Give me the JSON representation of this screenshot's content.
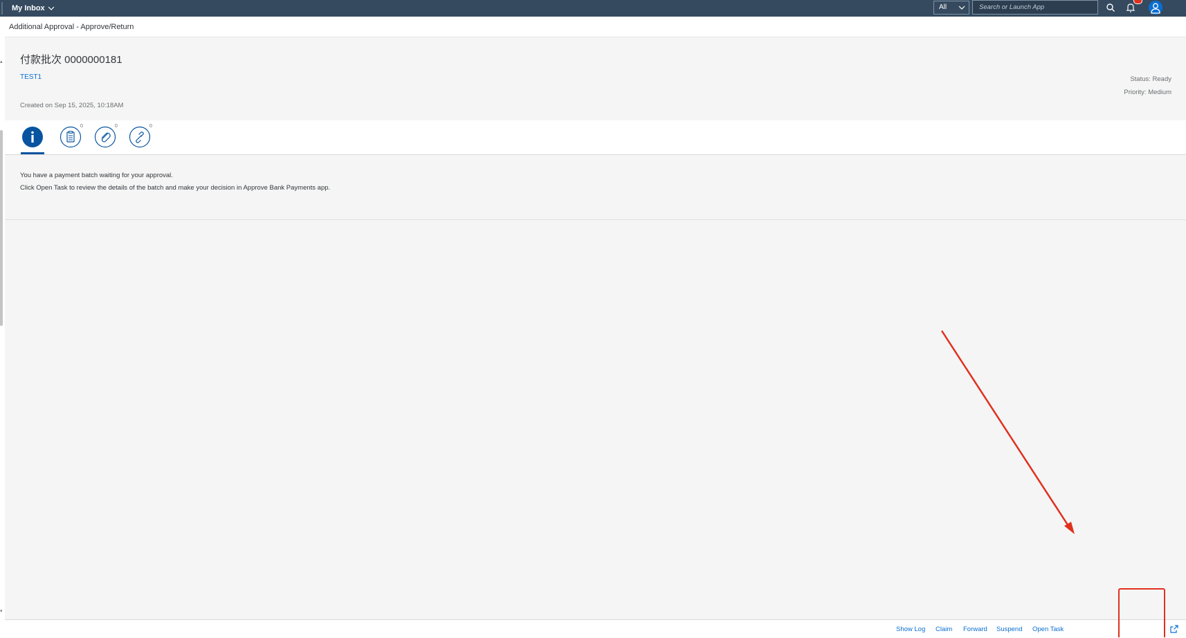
{
  "shell": {
    "title": "My Inbox",
    "scope_value": "All",
    "search_placeholder": "Search or Launch App"
  },
  "subheader": {
    "title": "Additional Approval - Approve/Return"
  },
  "header": {
    "title": "付款批次 0000000181",
    "link": "TEST1",
    "created": "Created on Sep 15, 2025, 10:18AM",
    "status": "Status: Ready",
    "priority": "Priority: Medium"
  },
  "tabs": [
    {
      "icon": "info-icon",
      "count": ""
    },
    {
      "icon": "notes-icon",
      "count": "0"
    },
    {
      "icon": "attachment-icon",
      "count": "0"
    },
    {
      "icon": "link-icon",
      "count": "0"
    }
  ],
  "description": {
    "line1": "You have a payment batch waiting for your approval.",
    "line2": "Click Open Task to review the details of the batch and make your decision in Approve Bank Payments app."
  },
  "footer": {
    "buttons": [
      "Show Log",
      "Claim",
      "Forward",
      "Suspend",
      "Open Task"
    ]
  },
  "colors": {
    "shell": "#354a5f",
    "link": "#0a6ed1",
    "selected_tab": "#0854a0",
    "annotation": "#e0301e"
  }
}
